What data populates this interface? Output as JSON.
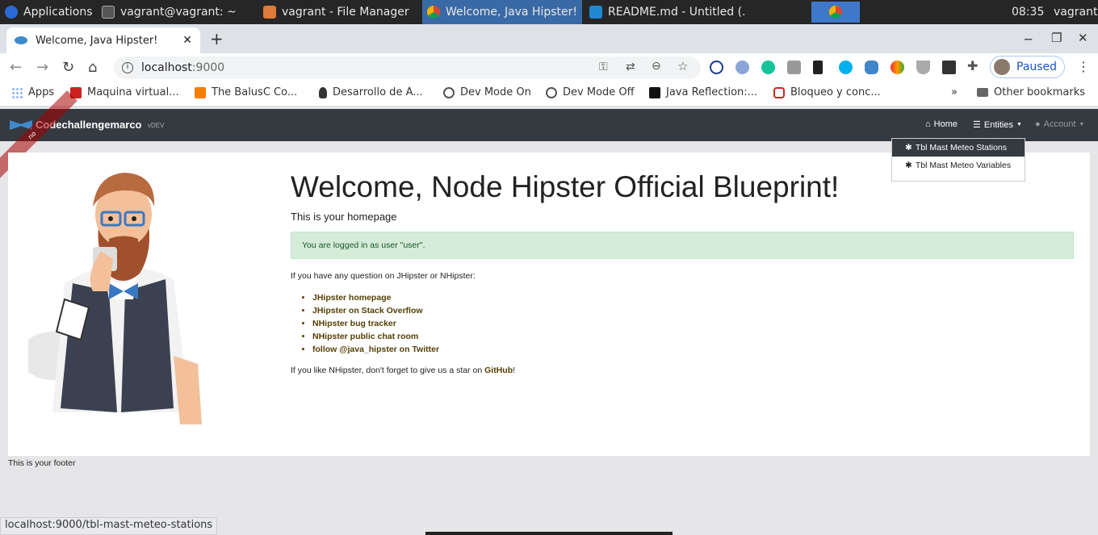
{
  "taskbar": {
    "apps_label": "Applications",
    "items": [
      "vagrant@vagrant: ~",
      "vagrant - File Manager",
      "Welcome, Java Hipster! ...",
      "README.md - Untitled (..."
    ],
    "clock": "08:35",
    "user": "vagrant"
  },
  "browser": {
    "tab_title": "Welcome, Java Hipster!",
    "url_host": "localhost",
    "url_port": ":9000",
    "profile_status": "Paused",
    "bookmarks": [
      "Apps",
      "Maquina virtual...",
      "The BalusC Co...",
      "Desarrollo de A...",
      "Dev Mode On",
      "Dev Mode Off",
      "Java Reflection:...",
      "Bloqueo y conc..."
    ],
    "other_bookmarks": "Other bookmarks",
    "more_bookmarks": "»"
  },
  "app": {
    "brand": "Codechallengemarco",
    "version": "vDEV",
    "ribbon": "no",
    "nav": {
      "home": "Home",
      "entities": "Entities",
      "account": "Account"
    },
    "dropdown": [
      "Tbl Mast Meteo Stations",
      "Tbl Mast Meteo Variables"
    ]
  },
  "content": {
    "title": "Welcome, Node Hipster Official Blueprint!",
    "subtitle": "This is your homepage",
    "alert": "You are logged in as user \"user\".",
    "question": "If you have any question on JHipster or NHipster:",
    "links": [
      "JHipster homepage",
      "JHipster on Stack Overflow",
      "NHipster bug tracker",
      "NHipster public chat room",
      "follow @java_hipster on Twitter"
    ],
    "star_prefix": "If you like NHipster, don't forget to give us a star on ",
    "star_link": "GitHub",
    "star_suffix": "!",
    "footer": "This is your footer"
  },
  "status_url": "localhost:9000/tbl-mast-meteo-stations",
  "colors": {
    "navbar": "#343a40",
    "alert_bg": "#d5ecd9",
    "link": "#533f03",
    "taskbar": "#262626"
  }
}
